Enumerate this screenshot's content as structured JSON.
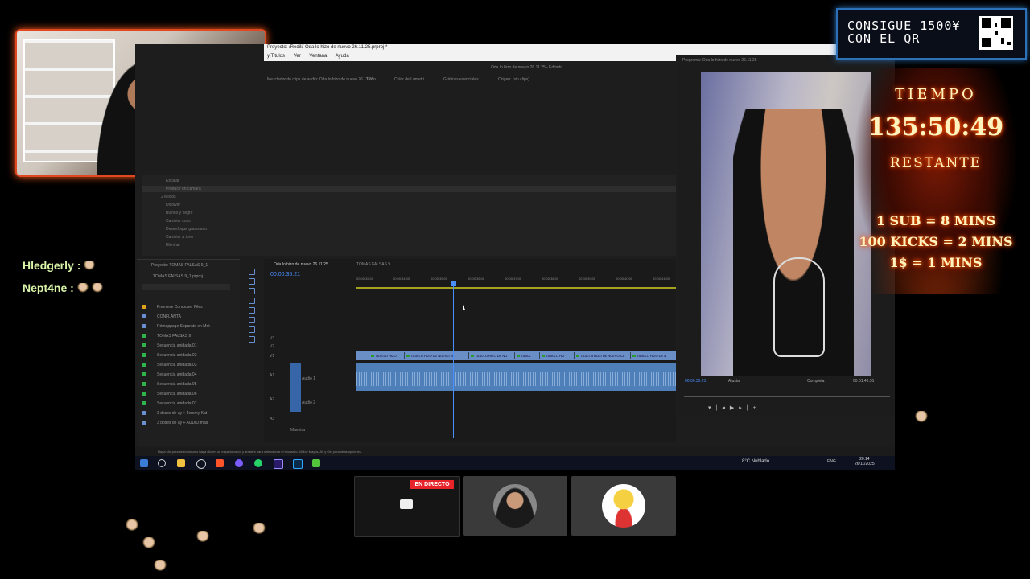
{
  "overlay": {
    "qr_banner": {
      "line1": "CONSIGUE 1500¥",
      "line2": "CON EL QR"
    },
    "timer": {
      "label_top": "TIEMPO",
      "time": "135:50:49",
      "label_bottom": "RESTANTE",
      "rules": [
        "1 SUB = 8 MINS",
        "100 KICKS = 2 MINS",
        "1$ = 1 MINS"
      ]
    },
    "chat": [
      {
        "user": "Hledgerly :",
        "emotes": 1
      },
      {
        "user": "Nept4ne :",
        "emotes": 2
      }
    ],
    "live_badge": "EN DIRECTO"
  },
  "premiere": {
    "title": "Proyecto: /Redili/ Oda lo hizo de nuevo 26.11.25.prproj *",
    "menu": [
      "y Titulos",
      "Ver",
      "Ventana",
      "Ayuda"
    ],
    "window_title": "Oda lo hizo de nuevo 26.11.25 - Editado",
    "panel_tabs": [
      "Mezclador de clips de audio: Oda lo hizo de nuevo 26.11.25",
      "Texto",
      "Color de Lumetri",
      "Gráficos esenciales",
      "Origen: (sin clips)"
    ],
    "effects_items": [
      "Escalar",
      "Producir en cámara",
      "2 Mixtos",
      "Disolver",
      "Blanco y negro",
      "Cambiar color",
      "Desenfoque gaussiano",
      "Cambiar a tono",
      "Eliminar"
    ],
    "project_panel": {
      "tab": "Proyecto: TOMAS FALSAS 9_1",
      "file": "TOMAS FALSAS 9_1.prproj",
      "items": [
        "Premiere Composer Files",
        "CONFLANTA",
        "Rémappage Separate en Mot",
        "TOMAS FALSAS 9",
        "Secuencia anidada 01",
        "Secuencia anidada 02",
        "Secuencia anidada 03",
        "Secuencia anidada 04",
        "Secuencia anidada 05",
        "Secuencia anidada 06",
        "Secuencia anidada 07",
        "3 doses de ay + Jeremy Kat",
        "3 doses de ay + AUDIO mas"
      ]
    },
    "timeline": {
      "tabs": [
        "Oda lo hizo de nuevo 26.11.25",
        "TOMAS FALSAS 9"
      ],
      "timecode": "00:00:35:21",
      "ruler": [
        "00:00:32:00",
        "00:00:34:00",
        "00:00:35:00",
        "00:00:36:00",
        "00:00:37:00",
        "00:00:38:00",
        "00:00:39:00",
        "00:00:40:00",
        "00:00:41:00"
      ],
      "video_clips": [
        "ODA LO HIZO",
        "ODA LO HIZO DE NUEVO 26",
        "ODA LO HIZO DE NU",
        "ODA L",
        "ODA LO HIZ",
        "ODA L A HIZO DE NUEVO CA",
        "ODA LO HIZO DE N"
      ],
      "tracks": [
        "V3",
        "V2",
        "V1",
        "A1",
        "A2",
        "A3",
        "Maestra"
      ],
      "track_names": [
        "Audio 1",
        "Audio 2"
      ]
    },
    "program": {
      "label": "Programa: Oda lo hizo de nuevo 26.11.25",
      "timecode": "00:00:35:21",
      "fit": "Ajustar",
      "quality": "Completa",
      "duration": "00:01:43:31"
    },
    "statusbar": "Haga clic para seleccionar o haga clic en un espacio vacío y arrastre para seleccionar el recuadro. Utilice Mayús, Alt y Ctrl para otras opciones."
  },
  "taskbar": {
    "weather": "8°C Nublado",
    "lang": "ENG",
    "time": "20:14",
    "date": "26/11/2025"
  },
  "colors": {
    "accent_blue": "#4a8fff",
    "live_red": "#e62429",
    "webcam_border": "#e0491f",
    "qr_border": "#2d72b8",
    "chat_green": "#d7f4a8"
  }
}
